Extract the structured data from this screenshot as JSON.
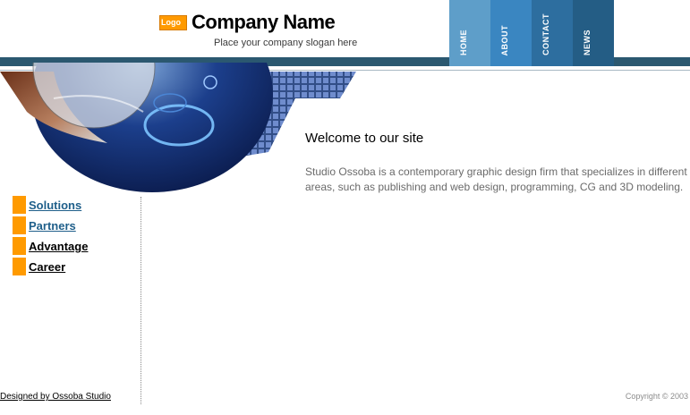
{
  "header": {
    "logo_text": "Logo",
    "company_name": "Company Name",
    "slogan": "Place your company slogan here"
  },
  "top_nav": [
    {
      "label": "HOME",
      "color": "#5e9ec9"
    },
    {
      "label": "ABOUT",
      "color": "#3a86c1"
    },
    {
      "label": "CONTACT",
      "color": "#2d6e9f"
    },
    {
      "label": "NEWS",
      "color": "#245d85"
    }
  ],
  "side_nav": [
    {
      "label": "Solutions",
      "color": "#1f5f8a"
    },
    {
      "label": "Partners",
      "color": "#1f5f8a"
    },
    {
      "label": "Advantage",
      "color": "#000000"
    },
    {
      "label": "Career",
      "color": "#000000"
    }
  ],
  "main": {
    "heading": "Welcome to our site",
    "text": "Studio Ossoba is a contemporary graphic design firm that specializes in different areas, such as publishing and web design, programming, CG and 3D modeling."
  },
  "footer": {
    "designed_by": "Designed by Ossoba Studio",
    "copyright": "Copyright © 2003"
  },
  "colors": {
    "accent": "#ff9a00",
    "header_bar": "#2b5870"
  }
}
